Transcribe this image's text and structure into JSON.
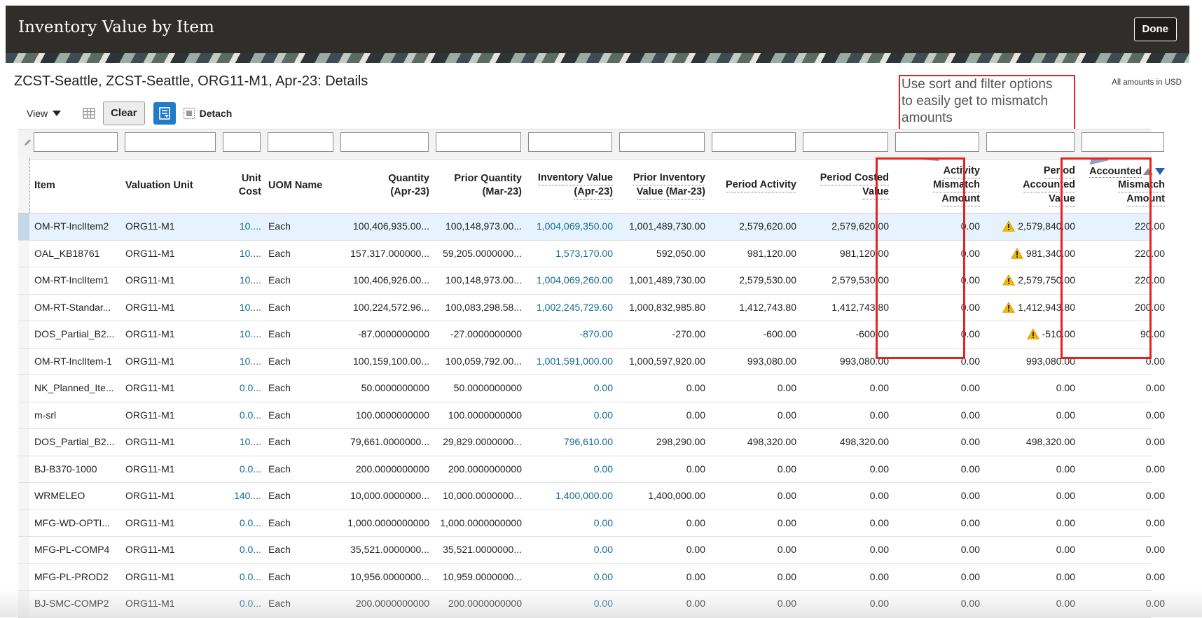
{
  "header": {
    "title": "Inventory Value by Item",
    "done_label": "Done"
  },
  "subtitle": "ZCST-Seattle, ZCST-Seattle, ORG11-M1, Apr-23: Details",
  "amounts_note": "All amounts in USD",
  "callout": {
    "lines": [
      "Use sort and filter options",
      "to easily get to mismatch",
      "amounts"
    ]
  },
  "toolbar": {
    "view_label": "View",
    "clear_label": "Clear",
    "detach_label": "Detach"
  },
  "columns": [
    {
      "lines": [
        "Item"
      ]
    },
    {
      "lines": [
        "Valuation Unit"
      ]
    },
    {
      "lines": [
        "Unit",
        "Cost"
      ]
    },
    {
      "lines": [
        "UOM Name"
      ]
    },
    {
      "lines": [
        "Quantity",
        "(Apr-23)"
      ]
    },
    {
      "lines": [
        "Prior Quantity",
        "(Mar-23)"
      ]
    },
    {
      "lines": [
        "Inventory Value",
        "(Apr-23)"
      ]
    },
    {
      "lines": [
        "Prior Inventory",
        "Value (Mar-23)"
      ]
    },
    {
      "lines": [
        "Period Activity"
      ]
    },
    {
      "lines": [
        "Period Costed",
        "Value"
      ]
    },
    {
      "lines": [
        "Activity",
        "Mismatch",
        "Amount"
      ]
    },
    {
      "lines": [
        "Period",
        "Accounted",
        "Value"
      ]
    },
    {
      "lines": [
        "Accounted",
        "Mismatch",
        "Amount"
      ]
    }
  ],
  "rows": [
    {
      "item": "OM-RT-InclItem2",
      "unit": "ORG11-M1",
      "cost": "10....",
      "uom": "Each",
      "qty": "100,406,935.00...",
      "prior_qty": "100,148,973.00...",
      "inv_value": "1,004,069,350.00",
      "prior_inv": "1,001,489,730.00",
      "activity": "2,579,620.00",
      "costed": "2,579,620.00",
      "act_mismatch": "0.00",
      "accounted": "2,579,840.00",
      "warn": true,
      "acc_mismatch": "220.00"
    },
    {
      "item": "OAL_KB18761",
      "unit": "ORG11-M1",
      "cost": "10....",
      "uom": "Each",
      "qty": "157,317.000000...",
      "prior_qty": "59,205.0000000...",
      "inv_value": "1,573,170.00",
      "prior_inv": "592,050.00",
      "activity": "981,120.00",
      "costed": "981,120.00",
      "act_mismatch": "0.00",
      "accounted": "981,340.00",
      "warn": true,
      "acc_mismatch": "220.00"
    },
    {
      "item": "OM-RT-InclItem1",
      "unit": "ORG11-M1",
      "cost": "10....",
      "uom": "Each",
      "qty": "100,406,926.00...",
      "prior_qty": "100,148,973.00...",
      "inv_value": "1,004,069,260.00",
      "prior_inv": "1,001,489,730.00",
      "activity": "2,579,530.00",
      "costed": "2,579,530.00",
      "act_mismatch": "0.00",
      "accounted": "2,579,750.00",
      "warn": true,
      "acc_mismatch": "220.00"
    },
    {
      "item": "OM-RT-Standar...",
      "unit": "ORG11-M1",
      "cost": "10....",
      "uom": "Each",
      "qty": "100,224,572.96...",
      "prior_qty": "100,083,298.58...",
      "inv_value": "1,002,245,729.60",
      "prior_inv": "1,000,832,985.80",
      "activity": "1,412,743.80",
      "costed": "1,412,743.80",
      "act_mismatch": "0.00",
      "accounted": "1,412,943.80",
      "warn": true,
      "acc_mismatch": "200.00"
    },
    {
      "item": "DOS_Partial_B2...",
      "unit": "ORG11-M1",
      "cost": "10....",
      "uom": "Each",
      "qty": "-87.0000000000",
      "prior_qty": "-27.0000000000",
      "inv_value": "-870.00",
      "prior_inv": "-270.00",
      "activity": "-600.00",
      "costed": "-600.00",
      "act_mismatch": "0.00",
      "accounted": "-510.00",
      "warn": true,
      "acc_mismatch": "90.00"
    },
    {
      "item": "OM-RT-InclItem-1",
      "unit": "ORG11-M1",
      "cost": "10....",
      "uom": "Each",
      "qty": "100,159,100.00...",
      "prior_qty": "100,059,792.00...",
      "inv_value": "1,001,591,000.00",
      "prior_inv": "1,000,597,920.00",
      "activity": "993,080.00",
      "costed": "993,080.00",
      "act_mismatch": "0.00",
      "accounted": "993,080.00",
      "warn": false,
      "acc_mismatch": "0.00"
    },
    {
      "item": "NK_Planned_Ite...",
      "unit": "ORG11-M1",
      "cost": "0.0...",
      "uom": "Each",
      "qty": "50.0000000000",
      "prior_qty": "50.0000000000",
      "inv_value": "0.00",
      "prior_inv": "0.00",
      "activity": "0.00",
      "costed": "0.00",
      "act_mismatch": "0.00",
      "accounted": "0.00",
      "warn": false,
      "acc_mismatch": "0.00"
    },
    {
      "item": "m-srl",
      "unit": "ORG11-M1",
      "cost": "0.0...",
      "uom": "Each",
      "qty": "100.0000000000",
      "prior_qty": "100.0000000000",
      "inv_value": "0.00",
      "prior_inv": "0.00",
      "activity": "0.00",
      "costed": "0.00",
      "act_mismatch": "0.00",
      "accounted": "0.00",
      "warn": false,
      "acc_mismatch": "0.00"
    },
    {
      "item": "DOS_Partial_B2...",
      "unit": "ORG11-M1",
      "cost": "10....",
      "uom": "Each",
      "qty": "79,661.0000000...",
      "prior_qty": "29,829.0000000...",
      "inv_value": "796,610.00",
      "prior_inv": "298,290.00",
      "activity": "498,320.00",
      "costed": "498,320.00",
      "act_mismatch": "0.00",
      "accounted": "498,320.00",
      "warn": false,
      "acc_mismatch": "0.00"
    },
    {
      "item": "BJ-B370-1000",
      "unit": "ORG11-M1",
      "cost": "0.0...",
      "uom": "Each",
      "qty": "200.0000000000",
      "prior_qty": "200.0000000000",
      "inv_value": "0.00",
      "prior_inv": "0.00",
      "activity": "0.00",
      "costed": "0.00",
      "act_mismatch": "0.00",
      "accounted": "0.00",
      "warn": false,
      "acc_mismatch": "0.00"
    },
    {
      "item": "WRMELEO",
      "unit": "ORG11-M1",
      "cost": "140....",
      "uom": "Each",
      "qty": "10,000.0000000...",
      "prior_qty": "10,000.0000000...",
      "inv_value": "1,400,000.00",
      "prior_inv": "1,400,000.00",
      "activity": "0.00",
      "costed": "0.00",
      "act_mismatch": "0.00",
      "accounted": "0.00",
      "warn": false,
      "acc_mismatch": "0.00"
    },
    {
      "item": "MFG-WD-OPTI...",
      "unit": "ORG11-M1",
      "cost": "0.0...",
      "uom": "Each",
      "qty": "1,000.0000000000",
      "prior_qty": "1,000.0000000000",
      "inv_value": "0.00",
      "prior_inv": "0.00",
      "activity": "0.00",
      "costed": "0.00",
      "act_mismatch": "0.00",
      "accounted": "0.00",
      "warn": false,
      "acc_mismatch": "0.00"
    },
    {
      "item": "MFG-PL-COMP4",
      "unit": "ORG11-M1",
      "cost": "0.0...",
      "uom": "Each",
      "qty": "35,521.0000000...",
      "prior_qty": "35,521.0000000...",
      "inv_value": "0.00",
      "prior_inv": "0.00",
      "activity": "0.00",
      "costed": "0.00",
      "act_mismatch": "0.00",
      "accounted": "0.00",
      "warn": false,
      "acc_mismatch": "0.00"
    },
    {
      "item": "MFG-PL-PROD2",
      "unit": "ORG11-M1",
      "cost": "0.0...",
      "uom": "Each",
      "qty": "10,956.0000000...",
      "prior_qty": "10,959.0000000...",
      "inv_value": "0.00",
      "prior_inv": "0.00",
      "activity": "0.00",
      "costed": "0.00",
      "act_mismatch": "0.00",
      "accounted": "0.00",
      "warn": false,
      "acc_mismatch": "0.00"
    },
    {
      "item": "BJ-SMC-COMP2",
      "unit": "ORG11-M1",
      "cost": "0.0...",
      "uom": "Each",
      "qty": "200.0000000000",
      "prior_qty": "200.0000000000",
      "inv_value": "0.00",
      "prior_inv": "0.00",
      "activity": "0.00",
      "costed": "0.00",
      "act_mismatch": "0.00",
      "accounted": "0.00",
      "warn": false,
      "acc_mismatch": "0.00"
    }
  ],
  "colors": {
    "header_bg": "#312d2a",
    "link": "#126a94",
    "selected_row": "#e6f2fd",
    "highlight": "#e52222",
    "warning": "#f2b705",
    "qbe_button": "#227bc9"
  }
}
